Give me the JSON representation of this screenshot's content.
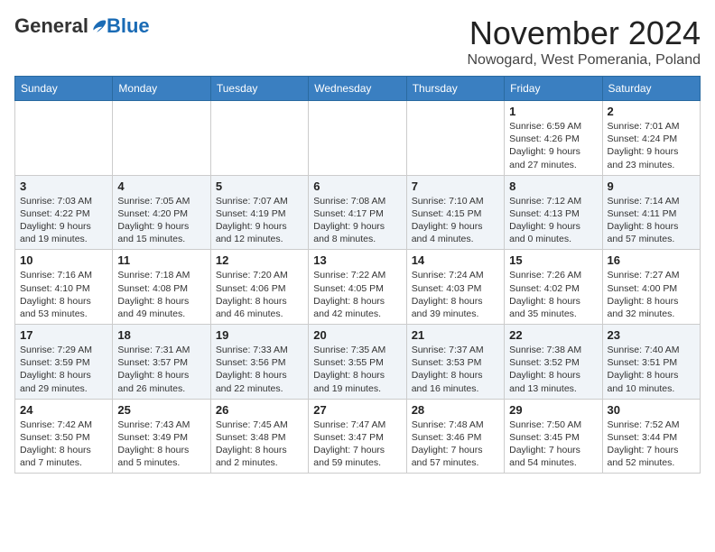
{
  "header": {
    "logo_general": "General",
    "logo_blue": "Blue",
    "month_title": "November 2024",
    "location": "Nowogard, West Pomerania, Poland"
  },
  "weekdays": [
    "Sunday",
    "Monday",
    "Tuesday",
    "Wednesday",
    "Thursday",
    "Friday",
    "Saturday"
  ],
  "weeks": [
    [
      {
        "day": "",
        "info": ""
      },
      {
        "day": "",
        "info": ""
      },
      {
        "day": "",
        "info": ""
      },
      {
        "day": "",
        "info": ""
      },
      {
        "day": "",
        "info": ""
      },
      {
        "day": "1",
        "info": "Sunrise: 6:59 AM\nSunset: 4:26 PM\nDaylight: 9 hours and 27 minutes."
      },
      {
        "day": "2",
        "info": "Sunrise: 7:01 AM\nSunset: 4:24 PM\nDaylight: 9 hours and 23 minutes."
      }
    ],
    [
      {
        "day": "3",
        "info": "Sunrise: 7:03 AM\nSunset: 4:22 PM\nDaylight: 9 hours and 19 minutes."
      },
      {
        "day": "4",
        "info": "Sunrise: 7:05 AM\nSunset: 4:20 PM\nDaylight: 9 hours and 15 minutes."
      },
      {
        "day": "5",
        "info": "Sunrise: 7:07 AM\nSunset: 4:19 PM\nDaylight: 9 hours and 12 minutes."
      },
      {
        "day": "6",
        "info": "Sunrise: 7:08 AM\nSunset: 4:17 PM\nDaylight: 9 hours and 8 minutes."
      },
      {
        "day": "7",
        "info": "Sunrise: 7:10 AM\nSunset: 4:15 PM\nDaylight: 9 hours and 4 minutes."
      },
      {
        "day": "8",
        "info": "Sunrise: 7:12 AM\nSunset: 4:13 PM\nDaylight: 9 hours and 0 minutes."
      },
      {
        "day": "9",
        "info": "Sunrise: 7:14 AM\nSunset: 4:11 PM\nDaylight: 8 hours and 57 minutes."
      }
    ],
    [
      {
        "day": "10",
        "info": "Sunrise: 7:16 AM\nSunset: 4:10 PM\nDaylight: 8 hours and 53 minutes."
      },
      {
        "day": "11",
        "info": "Sunrise: 7:18 AM\nSunset: 4:08 PM\nDaylight: 8 hours and 49 minutes."
      },
      {
        "day": "12",
        "info": "Sunrise: 7:20 AM\nSunset: 4:06 PM\nDaylight: 8 hours and 46 minutes."
      },
      {
        "day": "13",
        "info": "Sunrise: 7:22 AM\nSunset: 4:05 PM\nDaylight: 8 hours and 42 minutes."
      },
      {
        "day": "14",
        "info": "Sunrise: 7:24 AM\nSunset: 4:03 PM\nDaylight: 8 hours and 39 minutes."
      },
      {
        "day": "15",
        "info": "Sunrise: 7:26 AM\nSunset: 4:02 PM\nDaylight: 8 hours and 35 minutes."
      },
      {
        "day": "16",
        "info": "Sunrise: 7:27 AM\nSunset: 4:00 PM\nDaylight: 8 hours and 32 minutes."
      }
    ],
    [
      {
        "day": "17",
        "info": "Sunrise: 7:29 AM\nSunset: 3:59 PM\nDaylight: 8 hours and 29 minutes."
      },
      {
        "day": "18",
        "info": "Sunrise: 7:31 AM\nSunset: 3:57 PM\nDaylight: 8 hours and 26 minutes."
      },
      {
        "day": "19",
        "info": "Sunrise: 7:33 AM\nSunset: 3:56 PM\nDaylight: 8 hours and 22 minutes."
      },
      {
        "day": "20",
        "info": "Sunrise: 7:35 AM\nSunset: 3:55 PM\nDaylight: 8 hours and 19 minutes."
      },
      {
        "day": "21",
        "info": "Sunrise: 7:37 AM\nSunset: 3:53 PM\nDaylight: 8 hours and 16 minutes."
      },
      {
        "day": "22",
        "info": "Sunrise: 7:38 AM\nSunset: 3:52 PM\nDaylight: 8 hours and 13 minutes."
      },
      {
        "day": "23",
        "info": "Sunrise: 7:40 AM\nSunset: 3:51 PM\nDaylight: 8 hours and 10 minutes."
      }
    ],
    [
      {
        "day": "24",
        "info": "Sunrise: 7:42 AM\nSunset: 3:50 PM\nDaylight: 8 hours and 7 minutes."
      },
      {
        "day": "25",
        "info": "Sunrise: 7:43 AM\nSunset: 3:49 PM\nDaylight: 8 hours and 5 minutes."
      },
      {
        "day": "26",
        "info": "Sunrise: 7:45 AM\nSunset: 3:48 PM\nDaylight: 8 hours and 2 minutes."
      },
      {
        "day": "27",
        "info": "Sunrise: 7:47 AM\nSunset: 3:47 PM\nDaylight: 7 hours and 59 minutes."
      },
      {
        "day": "28",
        "info": "Sunrise: 7:48 AM\nSunset: 3:46 PM\nDaylight: 7 hours and 57 minutes."
      },
      {
        "day": "29",
        "info": "Sunrise: 7:50 AM\nSunset: 3:45 PM\nDaylight: 7 hours and 54 minutes."
      },
      {
        "day": "30",
        "info": "Sunrise: 7:52 AM\nSunset: 3:44 PM\nDaylight: 7 hours and 52 minutes."
      }
    ]
  ]
}
